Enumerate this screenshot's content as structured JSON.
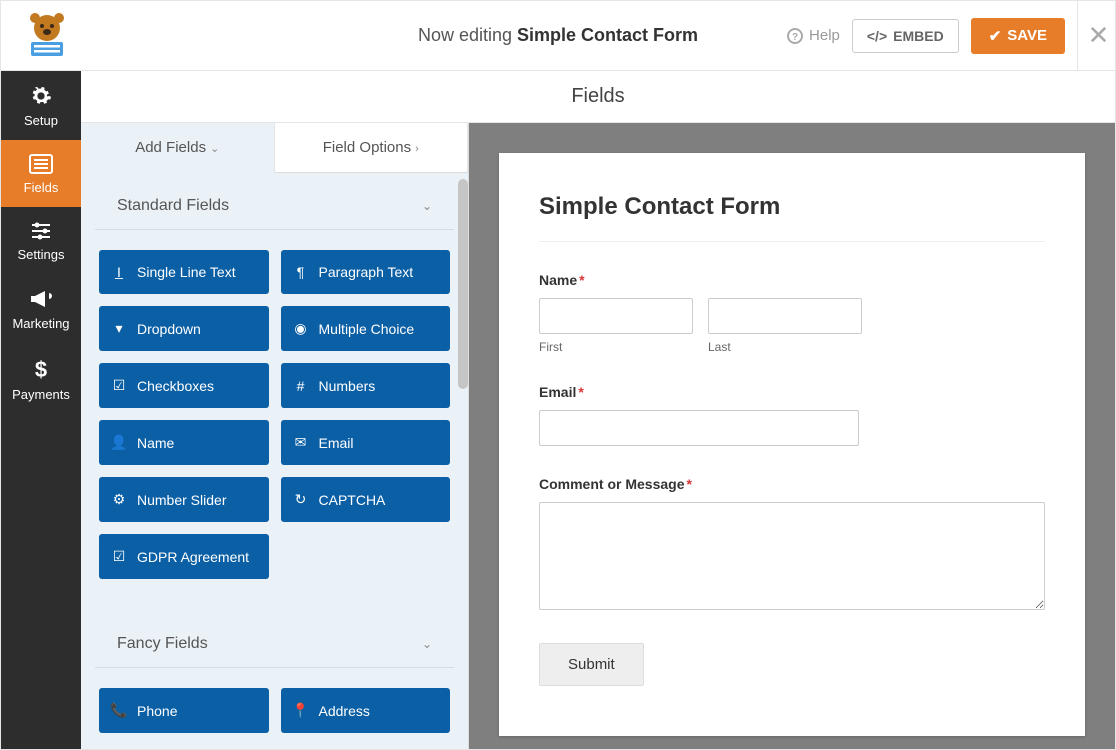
{
  "topbar": {
    "editing_prefix": "Now editing ",
    "form_name": "Simple Contact Form",
    "help": "Help",
    "embed": "EMBED",
    "save": "SAVE"
  },
  "nav": {
    "setup": "Setup",
    "fields": "Fields",
    "settings": "Settings",
    "marketing": "Marketing",
    "payments": "Payments"
  },
  "panel": {
    "title": "Fields",
    "tab_add": "Add Fields",
    "tab_options": "Field Options",
    "section_standard": "Standard Fields",
    "section_fancy": "Fancy Fields",
    "buttons": {
      "single_line": "Single Line Text",
      "paragraph": "Paragraph Text",
      "dropdown": "Dropdown",
      "multiple_choice": "Multiple Choice",
      "checkboxes": "Checkboxes",
      "numbers": "Numbers",
      "name": "Name",
      "email": "Email",
      "slider": "Number Slider",
      "captcha": "CAPTCHA",
      "gdpr": "GDPR Agreement",
      "phone": "Phone",
      "address": "Address"
    }
  },
  "preview": {
    "title": "Simple Contact Form",
    "name_label": "Name",
    "first": "First",
    "last": "Last",
    "email_label": "Email",
    "comment_label": "Comment or Message",
    "submit": "Submit"
  }
}
